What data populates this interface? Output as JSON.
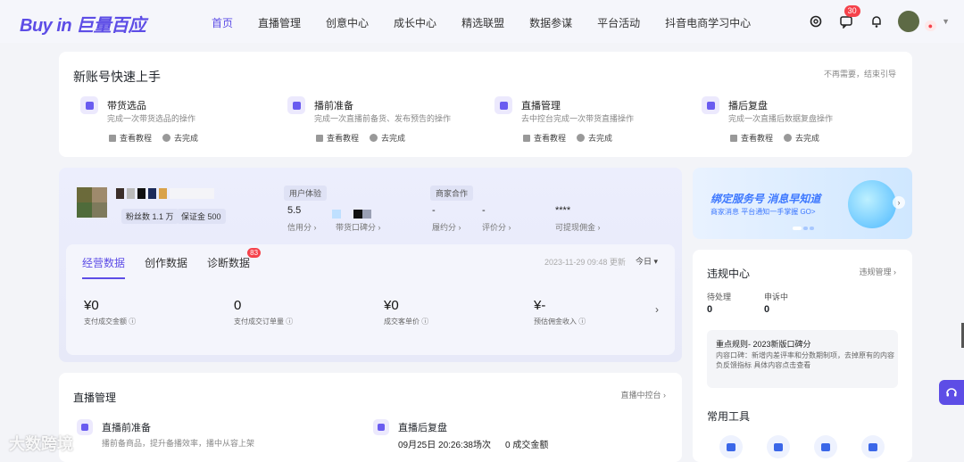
{
  "brand": {
    "logo_text": "Buy in 巨量百应",
    "accent": "#5d4de6"
  },
  "nav": {
    "items": [
      {
        "label": "首页",
        "active": true
      },
      {
        "label": "直播管理"
      },
      {
        "label": "创意中心"
      },
      {
        "label": "成长中心"
      },
      {
        "label": "精选联盟"
      },
      {
        "label": "数据参谋"
      },
      {
        "label": "平台活动"
      },
      {
        "label": "抖音电商学习中心"
      }
    ]
  },
  "topbar": {
    "message_badge": "30",
    "icons": [
      "settings-icon",
      "message-icon",
      "bell-icon"
    ]
  },
  "guide": {
    "title": "新账号快速上手",
    "skip": "不再需要，结束引导",
    "steps": [
      {
        "name": "带货选品",
        "desc": "完成一次带货选品的操作",
        "tutorial": "查看教程",
        "action": "去完成"
      },
      {
        "name": "播前准备",
        "desc": "完成一次直播前备货、发布预告的操作",
        "tutorial": "查看教程",
        "action": "去完成"
      },
      {
        "name": "直播管理",
        "desc": "去中控台完成一次带货直播操作",
        "tutorial": "查看教程",
        "action": "去完成"
      },
      {
        "name": "播后复盘",
        "desc": "完成一次直播后数据复盘操作",
        "tutorial": "查看教程",
        "action": "去完成"
      }
    ]
  },
  "account": {
    "fans": "粉丝数 1.1 万",
    "deposit": "保证金 500",
    "user_exp_tag": "用户体验",
    "merchant_tag": "商家合作",
    "credit_val": "5.5",
    "credit_lbl": "信用分 ›",
    "reputation_lbl": "带货口碑分 ›",
    "perf_val": "-",
    "perf_lbl": "履约分 ›",
    "eval_val": "-",
    "eval_lbl": "评价分 ›",
    "commission_val": "****",
    "commission_lbl": "可提现佣金 ›"
  },
  "panel": {
    "tabs": [
      {
        "label": "经营数据",
        "active": true
      },
      {
        "label": "创作数据"
      },
      {
        "label": "诊断数据",
        "badge": "83"
      }
    ],
    "updated": "2023-11-29 09:48 更新",
    "range": "今日 ▾",
    "kpis": [
      {
        "value": "¥0",
        "label": "支付成交金额 ⓘ"
      },
      {
        "value": "0",
        "label": "支付成交订单量 ⓘ"
      },
      {
        "value": "¥0",
        "label": "成交客单价 ⓘ"
      },
      {
        "value": "¥-",
        "label": "预估佣金收入 ⓘ"
      }
    ]
  },
  "banner": {
    "title": "绑定服务号 消息早知道",
    "subtitle": "商家消息 平台通知一手掌握 GO>"
  },
  "violation": {
    "title": "违规中心",
    "link": "违规管理 ›",
    "pending_lbl": "待处理",
    "pending_val": "0",
    "appeal_lbl": "申诉中",
    "appeal_val": "0",
    "rule_title": "重点规则- 2023新版口碑分",
    "rule_text": "内容口碑：新增内差评率和分数期制项，去掉原有的内容负反馈指标 具体内容点击查看"
  },
  "tools": {
    "title": "常用工具"
  },
  "live": {
    "title": "直播管理",
    "link": "直播中控台 ›",
    "pre_name": "直播前准备",
    "pre_desc": "播前备商品，提升备播效率，播中从容上架",
    "post_name": "直播后复盘",
    "post_time": "09月25日 20:26:38场次",
    "post_amount": "0 成交金额"
  },
  "watermark": "大数跨境"
}
